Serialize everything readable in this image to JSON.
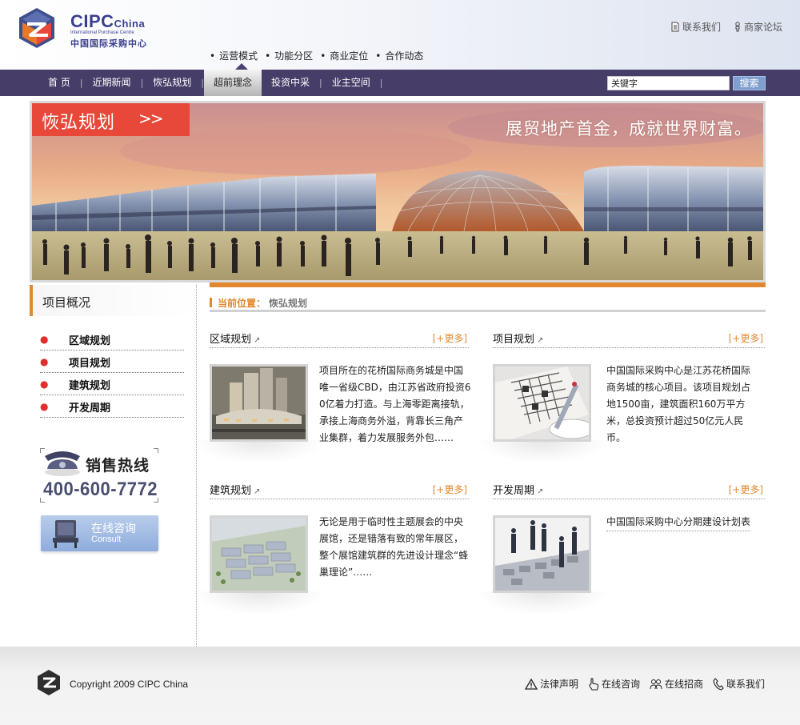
{
  "brand": {
    "name_en": "CIPC",
    "name_en_suffix": "China",
    "subtitle_en": "International Purchase Centre",
    "name_cn": "中国国际采购中心",
    "colors": {
      "primary": "#463d68",
      "accent": "#e1882e",
      "red": "#e8483a",
      "logo_orange": "#e87826"
    }
  },
  "toplinks": [
    {
      "label": "联系我们",
      "icon": "document-icon"
    },
    {
      "label": "商家论坛",
      "icon": "person-icon"
    }
  ],
  "subnav": [
    "运营模式",
    "功能分区",
    "商业定位",
    "合作动态"
  ],
  "nav": {
    "items": [
      {
        "label": "首 页",
        "active": false
      },
      {
        "label": "近期新闻",
        "active": false
      },
      {
        "label": "恢弘规划",
        "active": false
      },
      {
        "label": "超前理念",
        "active": true
      },
      {
        "label": "投资中采",
        "active": false
      },
      {
        "label": "业主空间",
        "active": false
      }
    ],
    "search_value": "关键字",
    "search_button": "搜索"
  },
  "banner": {
    "tag": "恢弘规划",
    "tag_arrows": ">>",
    "slogan": "展贸地产首金，成就世界财富。"
  },
  "sidebar": {
    "title": "项目概况",
    "items": [
      "区域规划",
      "项目规划",
      "建筑规划",
      "开发周期"
    ],
    "hotline_title": "销售热线",
    "hotline_number": "400-600-7772",
    "consult_cn": "在线咨询",
    "consult_en": "Consult"
  },
  "breadcrumb": {
    "label": "当前位置：",
    "value": "恢弘规划"
  },
  "sections": [
    {
      "title": "区域规划",
      "more": "[+更多]",
      "text": "项目所在的花桥国际商务城是中国唯一省级CBD，由江苏省政府投资60亿着力打造。与上海零距离接轨，承接上海商务外溢，背靠长三角产业集群，着力发展服务外包……",
      "thumb": "aerial-city-image"
    },
    {
      "title": "项目规划",
      "more": "[+更多]",
      "text": "中国国际采购中心是江苏花桥国际商务城的核心项目。该项目规划占地1500亩，建筑面积160万平方米，总投资预计超过50亿元人民币。",
      "thumb": "newspaper-pen-image"
    },
    {
      "title": "建筑规划",
      "more": "[+更多]",
      "text": "无论是用于临时性主题展会的中央展馆，还是错落有致的常年展区，整个展馆建筑群的先进设计理念“蜂巢理论”……",
      "thumb": "exhibition-complex-image"
    },
    {
      "title": "开发周期",
      "more": "[+更多]",
      "link": "中国国际采购中心分期建设计划表",
      "thumb": "business-figures-image"
    }
  ],
  "footer": {
    "copyright": "Copyright 2009  CIPC China",
    "links": [
      {
        "label": "法律声明",
        "icon": "warning-icon"
      },
      {
        "label": "在线咨询",
        "icon": "hand-pointer-icon"
      },
      {
        "label": "在线招商",
        "icon": "people-icon"
      },
      {
        "label": "联系我们",
        "icon": "phone-icon"
      }
    ]
  }
}
